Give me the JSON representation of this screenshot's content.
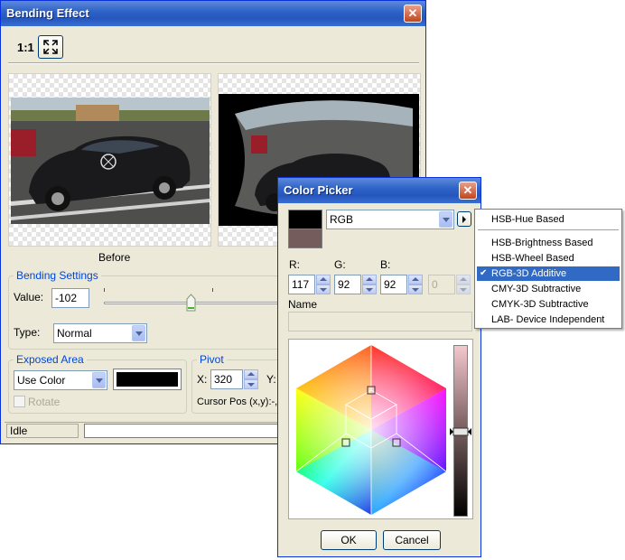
{
  "bending_window": {
    "title": "Bending Effect",
    "toolbar": {
      "zoom_label": "1:1"
    },
    "before_label": "Before",
    "settings": {
      "group_label": "Bending Settings",
      "value_label": "Value:",
      "value": "-102",
      "type_label": "Type:",
      "type_value": "Normal"
    },
    "exposed_area": {
      "group_label": "Exposed Area",
      "mode_value": "Use Color",
      "swatch_color": "#000000",
      "rotate_label": "Rotate"
    },
    "pivot": {
      "group_label": "Pivot",
      "x_label": "X:",
      "x_value": "320",
      "y_label": "Y:",
      "cursor_pos": "Cursor Pos (x,y):-,-"
    },
    "status": {
      "text": "Idle"
    }
  },
  "color_picker": {
    "title": "Color Picker",
    "new_color": "#000000",
    "old_color": "#755c5c",
    "mode_value": "RGB",
    "r_label": "R:",
    "g_label": "G:",
    "b_label": "B:",
    "r_value": "117",
    "g_value": "92",
    "b_value": "92",
    "extra_value": "0",
    "name_label": "Name",
    "ok_label": "OK",
    "cancel_label": "Cancel",
    "slider_level": 0.5,
    "menu": {
      "items": [
        {
          "label": "HSB-Hue Based",
          "selected": false
        },
        {
          "label": "HSB-Brightness Based",
          "selected": false
        },
        {
          "label": "HSB-Wheel Based",
          "selected": false
        },
        {
          "label": "RGB-3D Additive",
          "selected": true
        },
        {
          "label": "CMY-3D Subtractive",
          "selected": false
        },
        {
          "label": "CMYK-3D Subtractive",
          "selected": false
        },
        {
          "label": "LAB- Device Independent",
          "selected": false
        }
      ],
      "checkmark": "✔"
    }
  }
}
